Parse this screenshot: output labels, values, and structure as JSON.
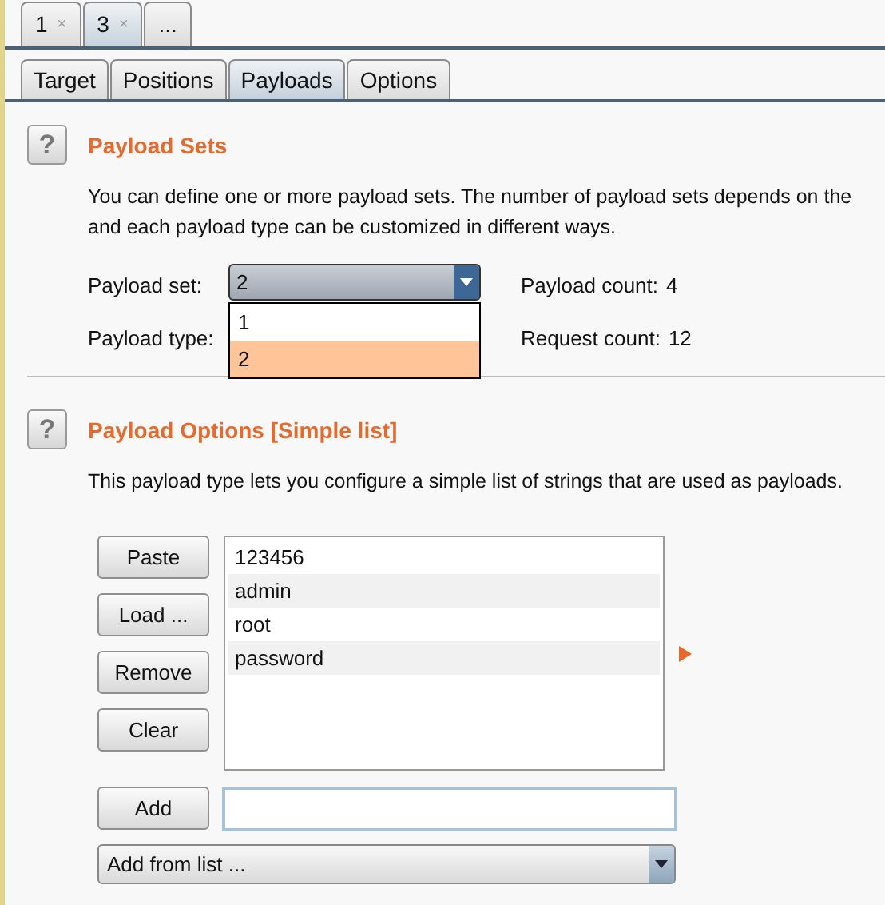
{
  "request_tabs": [
    {
      "label": "1",
      "close": "×",
      "selected": false
    },
    {
      "label": "3",
      "close": "×",
      "selected": true
    },
    {
      "label": "...",
      "selected": false
    }
  ],
  "tabs": [
    {
      "label": "Target",
      "selected": false
    },
    {
      "label": "Positions",
      "selected": false
    },
    {
      "label": "Payloads",
      "selected": true
    },
    {
      "label": "Options",
      "selected": false
    }
  ],
  "payload_sets": {
    "help": "?",
    "title": "Payload Sets",
    "description": "You can define one or more payload sets. The number of payload sets depends on the",
    "description_2": "and each payload type can be customized in different ways.",
    "set_label": "Payload set:",
    "set_value": "2",
    "type_label": "Payload type:",
    "set_options": [
      {
        "label": "1",
        "selected": false
      },
      {
        "label": "2",
        "selected": true
      }
    ],
    "payload_count_label": "Payload count:",
    "payload_count": "4",
    "request_count_label": "Request count:",
    "request_count": "12"
  },
  "payload_options": {
    "help": "?",
    "title": "Payload Options [Simple list]",
    "description": "This payload type lets you configure a simple list of strings that are used as payloads.",
    "buttons": [
      "Paste",
      "Load ...",
      "Remove",
      "Clear"
    ],
    "items": [
      "123456",
      "admin",
      "root",
      "password"
    ],
    "add_button": "Add",
    "add_from_list": "Add from list ..."
  }
}
